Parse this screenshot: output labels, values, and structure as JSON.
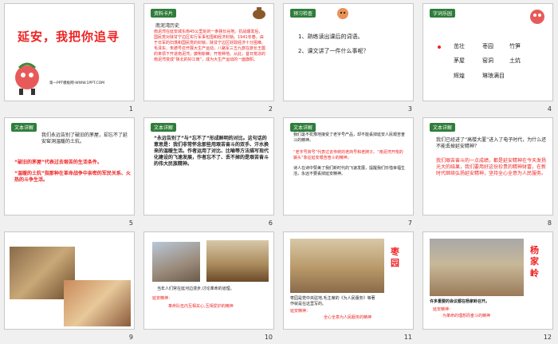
{
  "slides": [
    {
      "n": "1",
      "title": "延安，我把你追寻",
      "footer": "第一PPT模板网-WWW.1PPT.COM"
    },
    {
      "n": "2",
      "tag": "资料卡片",
      "heading": "南泥湾历史",
      "body": "南泥湾在延安城东南45公里处的一条狭长谷地。抗战爆发后，国民党对陕甘宁边区实行军事包围和经济封锁。1941年春，由于日军的扫荡和国民党的封锁，陕甘宁边区财政经济十分困难。毛泽东、朱德号召开展大生产运动，八路军三五九旅在旅长王震的率领下开进南泥湾，披荆斩棘，开荒种地。从此，昔日荒凉的南泥湾变成“陕北的好江南”，成为大生产运动的一面旗帜。"
    },
    {
      "n": "3",
      "tag": "预习检查",
      "items": [
        "1、熟练读出课后的词语。",
        "2、课文讲了一件什么事呢？"
      ]
    },
    {
      "n": "4",
      "tag": "字词乐园",
      "words": [
        "茁壮",
        "枣园",
        "竹笋",
        "茅屋",
        "窑洞",
        "土炕",
        "辉煌",
        "琳琅满目"
      ]
    },
    {
      "n": "5",
      "tag": "文本详解",
      "lead": "我们永远告别了破旧的茅屋，却忘不了延安窑洞温暖的土炕。",
      "l1": "“破旧的茅屋”代表过去艰苦的生活条件。",
      "l2": "“温暖的土炕”指那种在革命战争中亲密的军民关系、火热的斗争生活。"
    },
    {
      "n": "6",
      "tag": "文本详解",
      "body": "“永远告别了”与“忘不了”形成鲜明的对比。这句话的意思是：我们非常怀念那些用艰苦奋斗的双手、汗水换来的温暖生活。作者运用了对比、比喻等方法描写现代化建设的飞速发展，作者忘不了、丢不掉的是艰苦奋斗的伟大民族精神。"
    },
    {
      "n": "7",
      "tag": "文本详解",
      "lead": "我们毫不犹豫地接受了老字号产品，却不能丢掉延安人民艰苦奋斗的精神。",
      "red": "“老字号商号”代表过去传统的老商号和老牌子。“南泥湾开荒的镢头”象征延安艰苦奋斗的精神。",
      "more": "诗人在诗中赞美了我们新时代的飞速发展，提醒我们珍惜幸福生活，永远不要丢掉延安精神。"
    },
    {
      "n": "8",
      "tag": "文本详解",
      "q": "我们已经进了“高楼大厦”进入了电子时代，为什么还不能丢掉延安精神？",
      "a": "我们艰苦奋斗的一点成绩，都是延安精神在今天发扬光大的结果，我们要用好这份珍贵的精神财富，在新时代继续弘扬延安精神，坚持全心全意为人民服务。"
    },
    {
      "n": "9"
    },
    {
      "n": "10",
      "caption": "当年人们常在延河边漫步,讨论革命的道理。",
      "label": "延安精神：",
      "sub": "革命队伍内互相关心,互相爱护的精神"
    },
    {
      "n": "11",
      "side": "枣园",
      "caption": "枣园是党中央驻地,毛主席的《为人民服务》等著作就是在这里写的。",
      "label": "延安精神：",
      "sub": "全心全意为人民服务的精神"
    },
    {
      "n": "12",
      "side": "杨家岭",
      "caption": "许多重要的会议都在杨家岭召开。",
      "label": "延安精神：",
      "sub": "为革命的理想而奋斗的精神"
    }
  ]
}
